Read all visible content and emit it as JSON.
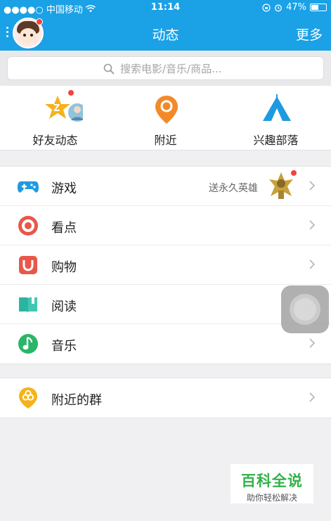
{
  "status_bar": {
    "carrier": "●●●●○ 中国移动",
    "time": "11:14",
    "battery": "47%"
  },
  "header": {
    "title": "动态",
    "more_label": "更多"
  },
  "search": {
    "placeholder": "搜索电影/音乐/商品..."
  },
  "quick_items": [
    {
      "label": "好友动态",
      "icon": "friends-feed-icon",
      "color": "#f6b21a"
    },
    {
      "label": "附近",
      "icon": "location-pin-icon",
      "color": "#f38a2a"
    },
    {
      "label": "兴趣部落",
      "icon": "tent-icon",
      "color": "#1e9be0"
    }
  ],
  "list_main": [
    {
      "label": "游戏",
      "icon": "gamepad-icon",
      "color": "#1e9be0",
      "note": "送永久英雄"
    },
    {
      "label": "看点",
      "icon": "eye-icon",
      "color": "#e8574a"
    },
    {
      "label": "购物",
      "icon": "shopping-bag-icon",
      "color": "#e8574a"
    },
    {
      "label": "阅读",
      "icon": "book-icon",
      "color": "#2bb5a0"
    },
    {
      "label": "音乐",
      "icon": "music-note-icon",
      "color": "#2bb56a"
    }
  ],
  "list_group": [
    {
      "label": "附近的群",
      "icon": "nearby-group-icon",
      "color": "#f6b21a"
    }
  ],
  "watermark": {
    "title": "百科全说",
    "subtitle": "助你轻松解决"
  }
}
